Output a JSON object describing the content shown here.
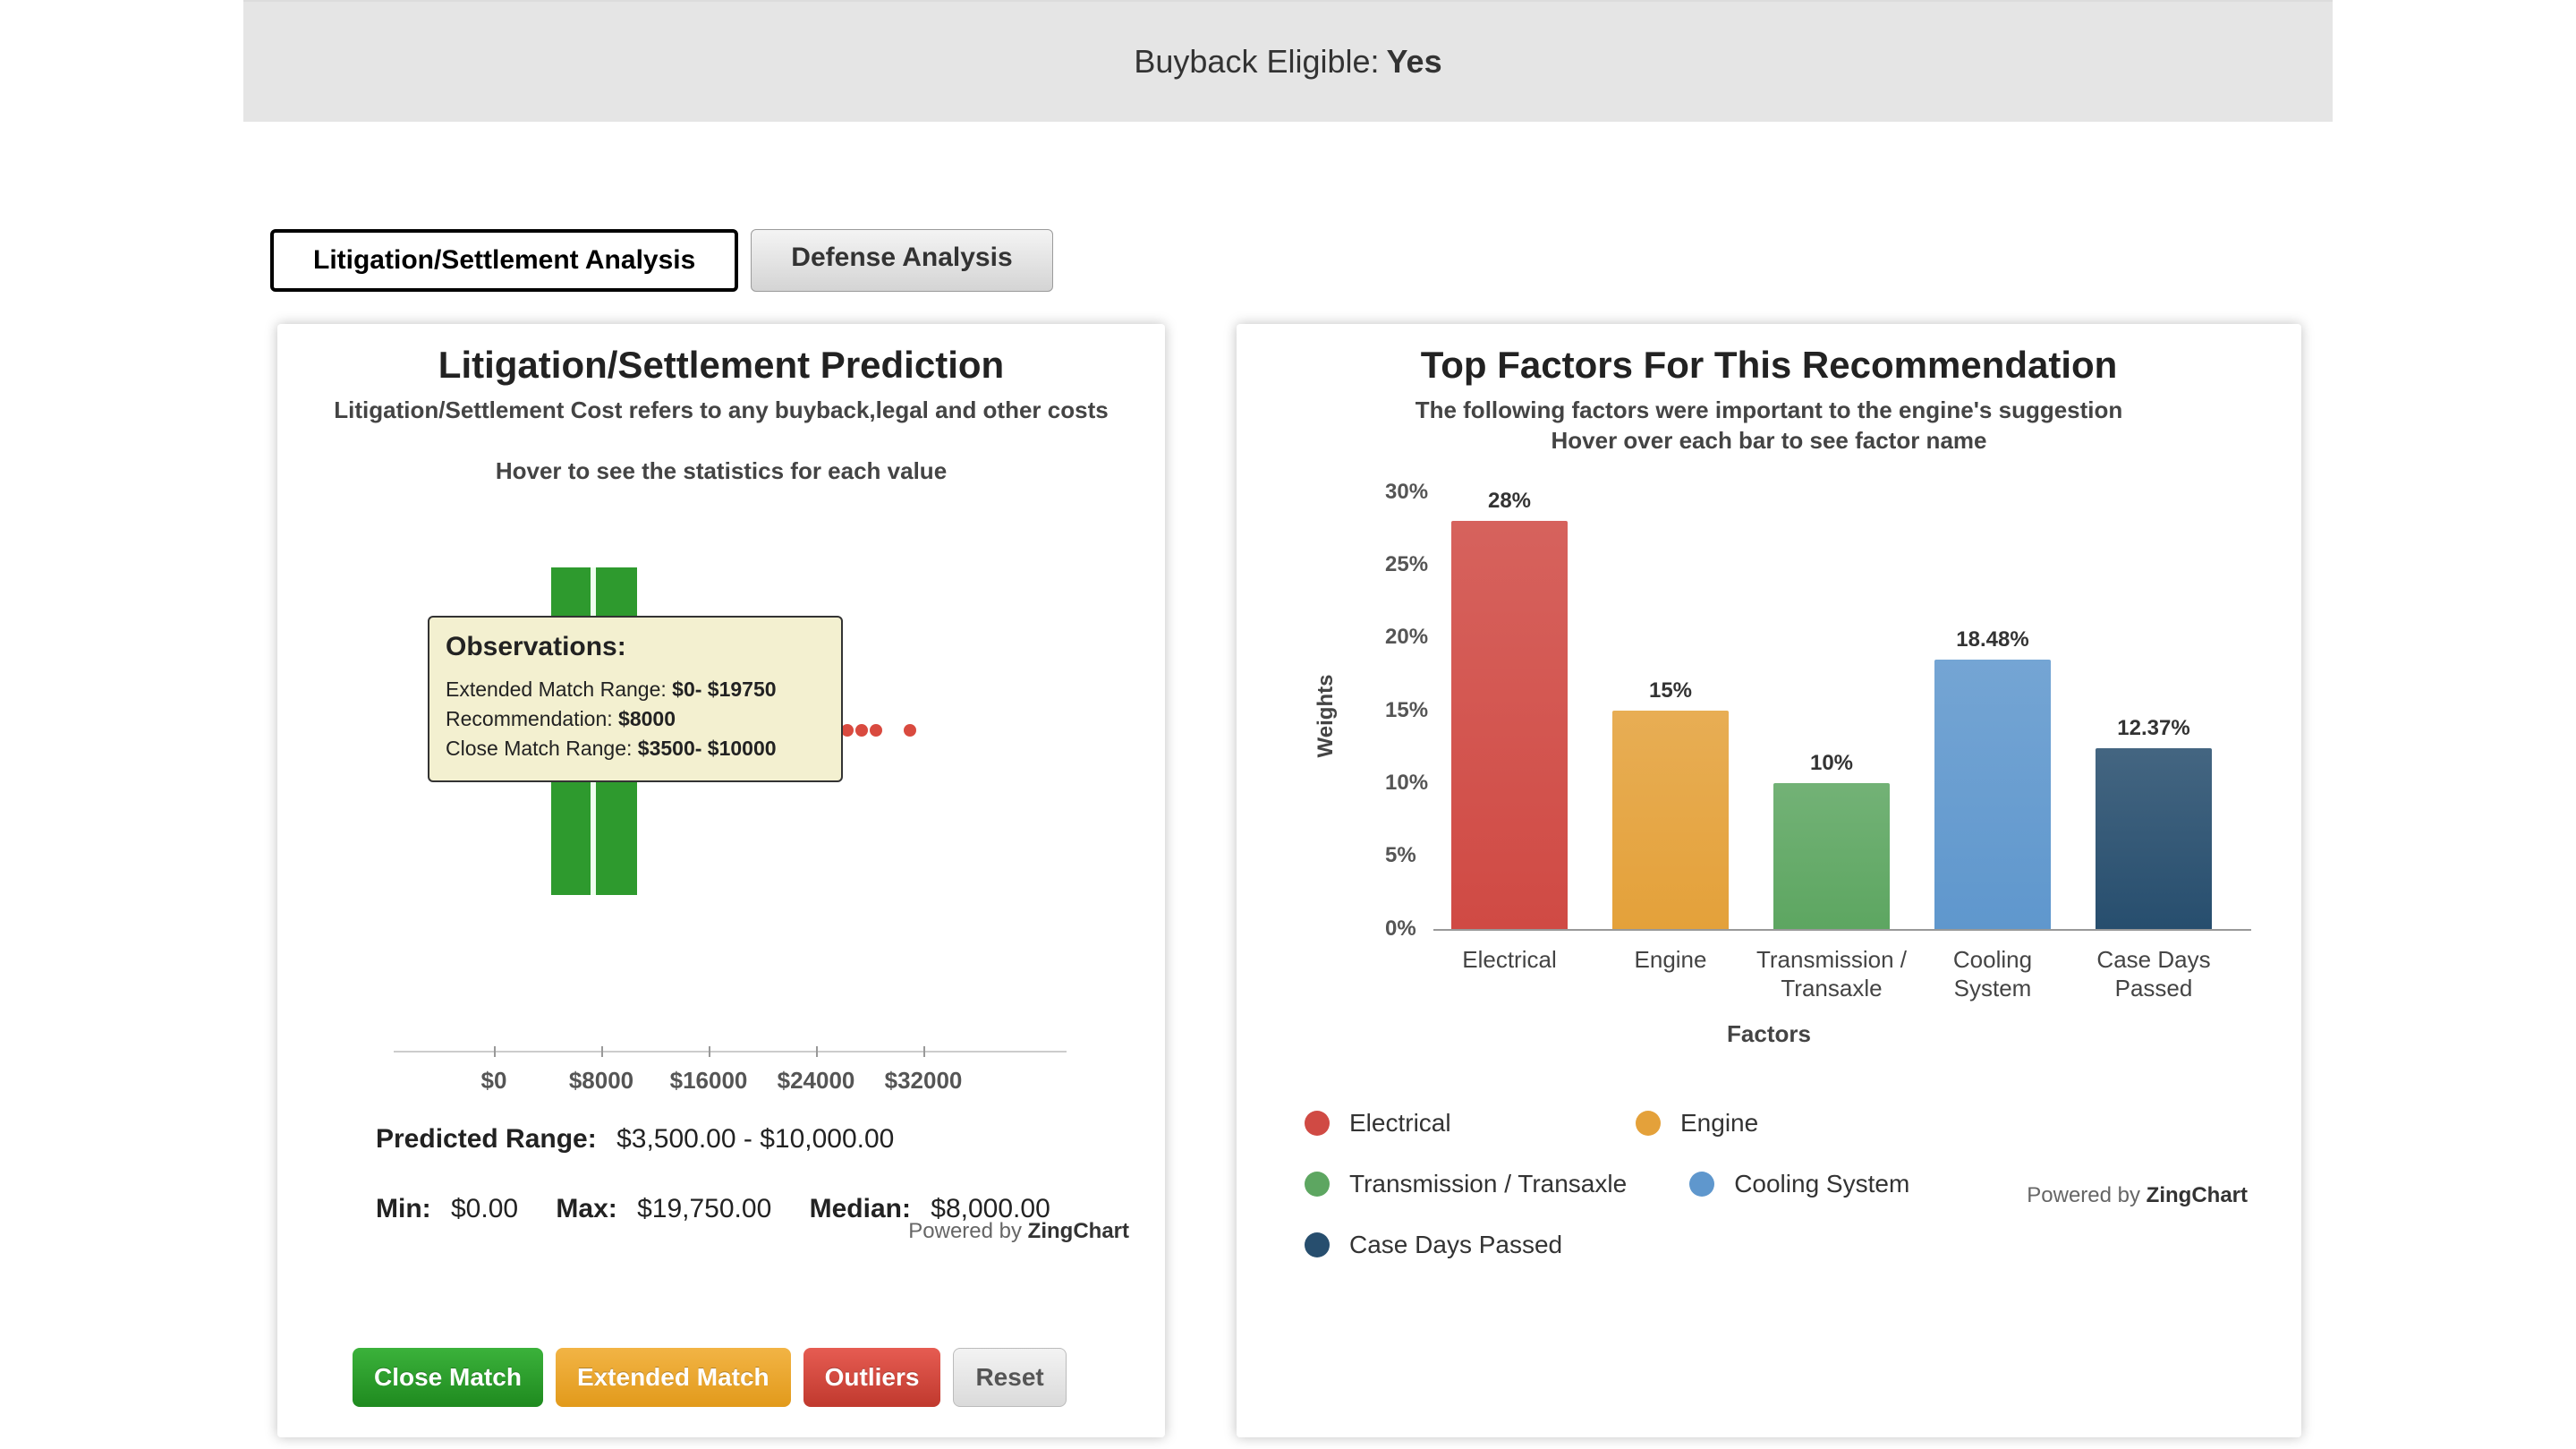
{
  "banner": {
    "label": "Buyback Eligible:",
    "value": "Yes"
  },
  "tabs": {
    "active": "Litigation/Settlement Analysis",
    "inactive": "Defense Analysis"
  },
  "left": {
    "title": "Litigation/Settlement Prediction",
    "sub1": "Litigation/Settlement Cost refers to any buyback,legal and other costs",
    "sub2": "Hover to see the statistics for each value",
    "tooltip": {
      "title": "Observations:",
      "l1a": "Extended Match Range: ",
      "l1b": "$0- $19750",
      "l2a": "Recommendation: ",
      "l2b": "$8000",
      "l3a": "Close Match Range: ",
      "l3b": "$3500- $10000"
    },
    "ticks": [
      "$0",
      "$8000",
      "$16000",
      "$24000",
      "$32000"
    ],
    "powered": "Powered by ",
    "poweredb": "ZingChart",
    "predicted_label": "Predicted Range:",
    "predicted_value": "$3,500.00 - $10,000.00",
    "min_label": "Min:",
    "min_value": "$0.00",
    "max_label": "Max:",
    "max_value": "$19,750.00",
    "median_label": "Median:",
    "median_value": "$8,000.00",
    "btn_close": "Close Match",
    "btn_ext": "Extended Match",
    "btn_out": "Outliers",
    "btn_reset": "Reset"
  },
  "right": {
    "title": "Top Factors For This Recommendation",
    "sub1": "The following factors were important to the engine's suggestion",
    "sub2": "Hover over each bar to see factor name",
    "ylabel": "Weights",
    "xlabel": "Factors",
    "yticks": [
      "0%",
      "5%",
      "10%",
      "15%",
      "20%",
      "25%",
      "30%"
    ],
    "powered": "Powered by ",
    "poweredb": "ZingChart"
  },
  "chart_data": {
    "type": "bar",
    "title": "Top Factors For This Recommendation",
    "xlabel": "Factors",
    "ylabel": "Weights",
    "ylim": [
      0,
      30
    ],
    "categories": [
      "Electrical",
      "Engine",
      "Transmission / Transaxle",
      "Cooling System",
      "Case Days Passed"
    ],
    "values": [
      28,
      15,
      10,
      18.48,
      12.37
    ],
    "labels": [
      "28%",
      "15%",
      "10%",
      "18.48%",
      "12.37%"
    ],
    "colors": [
      "#d04a44",
      "#e4a13a",
      "#5da661",
      "#5f97cd",
      "#274e6e"
    ]
  }
}
